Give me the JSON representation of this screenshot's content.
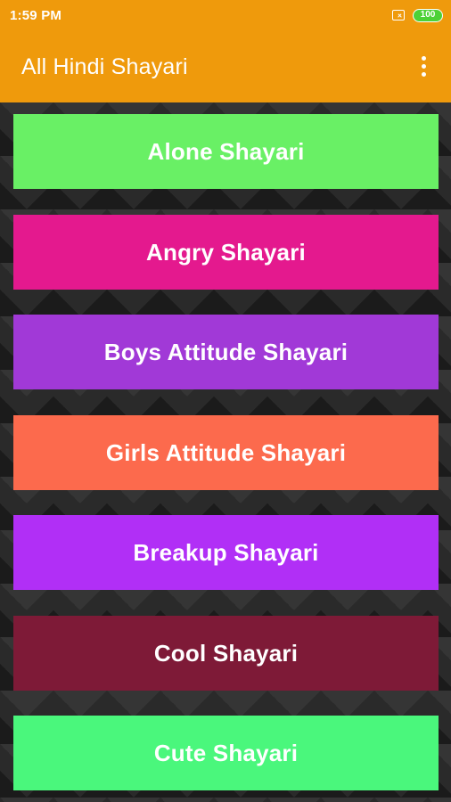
{
  "status_bar": {
    "time": "1:59 PM",
    "sim_icon": "no-sim-icon",
    "battery_level": "100",
    "battery_color": "#4CD137"
  },
  "app_bar": {
    "title": "All Hindi Shayari",
    "background": "#EF9A0C",
    "menu_icon": "more-vert-icon"
  },
  "categories": [
    {
      "label": "Alone Shayari",
      "color": "#69F065"
    },
    {
      "label": "Angry Shayari",
      "color": "#E4198E"
    },
    {
      "label": "Boys Attitude Shayari",
      "color": "#A139D7"
    },
    {
      "label": "Girls Attitude Shayari",
      "color": "#FC6A4D"
    },
    {
      "label": "Breakup Shayari",
      "color": "#B12FF6"
    },
    {
      "label": "Cool Shayari",
      "color": "#7E1A37"
    },
    {
      "label": "Cute Shayari",
      "color": "#4AF77C"
    }
  ]
}
